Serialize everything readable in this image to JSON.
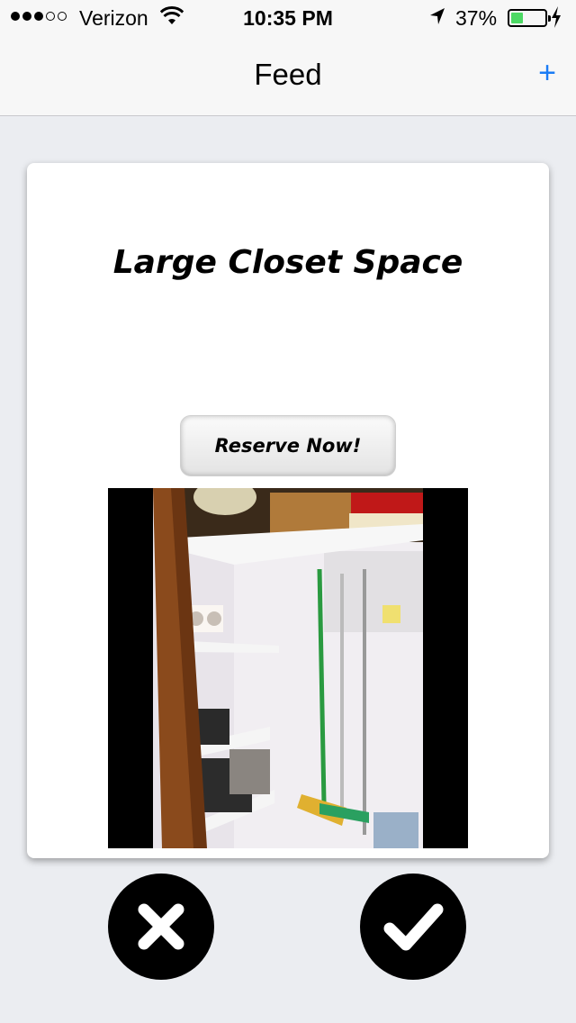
{
  "status_bar": {
    "carrier": "Verizon",
    "time": "10:35 PM",
    "battery_percent": "37%",
    "battery_level": 0.37,
    "signal_bars_filled": 3,
    "signal_bars_total": 5
  },
  "nav": {
    "title": "Feed",
    "add_label": "+"
  },
  "card": {
    "title": "Large Closet Space",
    "reserve_label": "Reserve Now!"
  },
  "actions": {
    "reject_icon": "close-icon",
    "accept_icon": "checkmark-icon"
  },
  "colors": {
    "accent": "#1a7cf5",
    "background": "#ebedf1",
    "battery": "#4cd964"
  }
}
